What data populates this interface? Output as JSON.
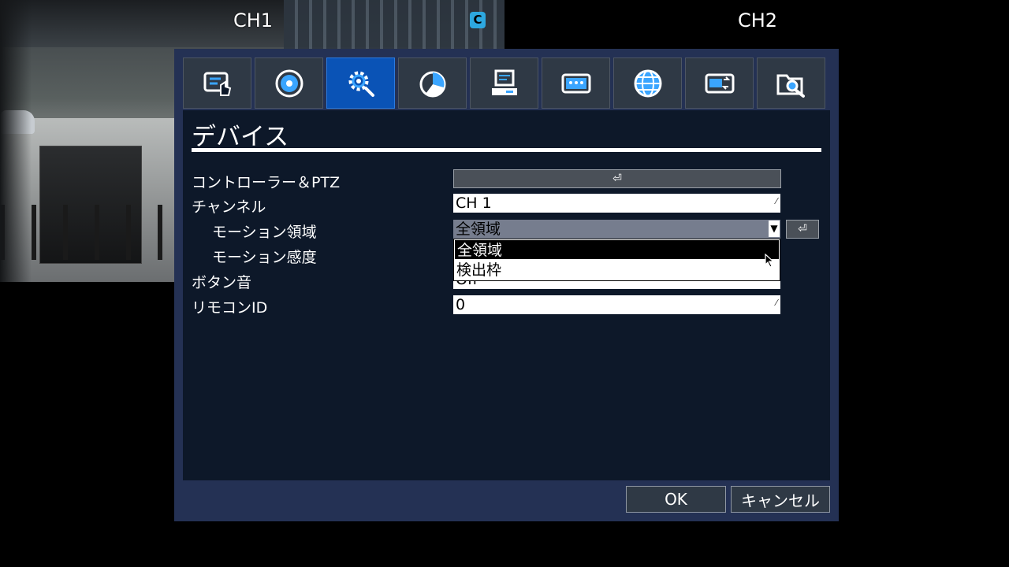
{
  "cameras": {
    "ch1_label": "CH1",
    "ch2_label": "CH2",
    "rec_badge": "C"
  },
  "tabs": [
    {
      "icon": "touch-display-icon",
      "active": false
    },
    {
      "icon": "disc-icon",
      "active": false
    },
    {
      "icon": "gear-icon",
      "active": true
    },
    {
      "icon": "pie-chart-icon",
      "active": false
    },
    {
      "icon": "computer-icon",
      "active": false
    },
    {
      "icon": "password-icon",
      "active": false
    },
    {
      "icon": "globe-icon",
      "active": false
    },
    {
      "icon": "storage-transfer-icon",
      "active": false
    },
    {
      "icon": "search-folder-icon",
      "active": false
    }
  ],
  "page": {
    "title": "デバイス"
  },
  "settings": {
    "controller_label": "コントローラー＆PTZ",
    "controller_button": "⏎",
    "channel_label": "チャンネル",
    "channel_value": "CH 1",
    "motion_area_label": "モーション領域",
    "motion_area_value": "全領域",
    "motion_sensitivity_label": "モーション感度",
    "button_sound_label": "ボタン音",
    "button_sound_value": "Off",
    "remote_id_label": "リモコンID",
    "remote_id_value": "0",
    "side_button": "⏎"
  },
  "dropdown": {
    "options": [
      "全領域",
      "検出枠"
    ],
    "selected_index": 0
  },
  "footer": {
    "ok": "OK",
    "cancel": "キャンセル"
  },
  "colors": {
    "dialog_bg": "#243154",
    "content_bg": "#0d1829",
    "tab_active": "#0a53b6",
    "tab_inactive": "#2f3945",
    "icon_blue": "#3aa5ff"
  }
}
